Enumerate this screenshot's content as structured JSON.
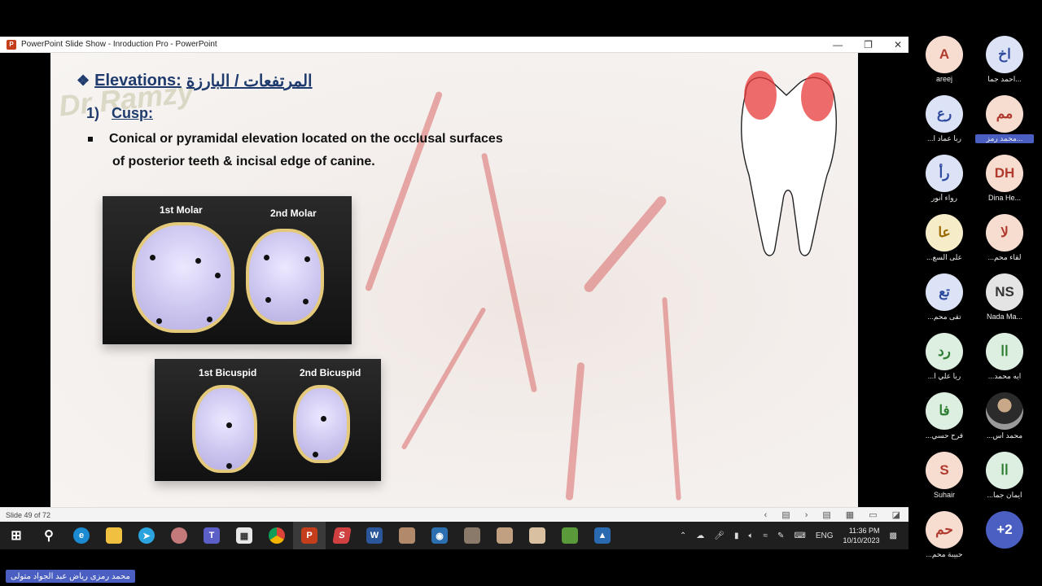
{
  "window": {
    "title": "PowerPoint Slide Show - Inroduction Pro - PowerPoint",
    "app_icon": "P"
  },
  "slide": {
    "title_en": "Elevations:",
    "title_ar": "المرتفعات / البارزة",
    "watermark": "Dr Ramzy",
    "sub_number": "1)",
    "sub_label": "Cusp:",
    "bullet_line1": "Conical or pyramidal elevation located on the occlusal surfaces",
    "bullet_line2": "of posterior teeth & incisal edge of canine.",
    "photos": {
      "molar1": "1st Molar",
      "molar2": "2nd Molar",
      "bicuspid1": "1st Bicuspid",
      "bicuspid2": "2nd Bicuspid"
    }
  },
  "status": {
    "slide_counter": "Slide 49 of 72"
  },
  "taskbar": {
    "icons": [
      "windows-start-icon",
      "search-icon",
      "edge-icon",
      "file-explorer-icon",
      "telegram-icon",
      "app-icon",
      "teams-icon",
      "store-icon",
      "chrome-icon",
      "powerpoint-icon",
      "app-icon",
      "word-icon",
      "photo-icon",
      "app-icon",
      "photo-icon",
      "photo-icon",
      "photo-icon",
      "minecraft-icon",
      "app-icon"
    ],
    "language": "ENG",
    "time": "11:36 PM",
    "date": "10/10/2023"
  },
  "participants": [
    {
      "initials": "A",
      "name": "areej",
      "bg": "#f7dcd0",
      "fg": "#b03a2e"
    },
    {
      "initials": "اخ",
      "name": "احمد جما...",
      "bg": "#dce3f7",
      "fg": "#2e4a9e"
    },
    {
      "initials": "رع",
      "name": "...ربا عماد ا",
      "bg": "#dce3f7",
      "fg": "#2e4a9e"
    },
    {
      "initials": "مم",
      "name": "محمد رمز...",
      "bg": "#f7dcd0",
      "fg": "#b03a2e",
      "highlight": true
    },
    {
      "initials": "رأ",
      "name": "رواء أنور",
      "bg": "#dce3f7",
      "fg": "#2e4a9e"
    },
    {
      "initials": "DH",
      "name": "Dina He...",
      "bg": "#f7dcd0",
      "fg": "#b03a2e"
    },
    {
      "initials": "عا",
      "name": "...على السع",
      "bg": "#f7ecc8",
      "fg": "#9a6a00"
    },
    {
      "initials": "لا",
      "name": "...لقاء محم",
      "bg": "#f7dcd0",
      "fg": "#b03a2e"
    },
    {
      "initials": "تع",
      "name": "...تقى محم",
      "bg": "#dce3f7",
      "fg": "#2e4a9e"
    },
    {
      "initials": "NS",
      "name": "Nada Ma...",
      "bg": "#e4e4e4",
      "fg": "#333333"
    },
    {
      "initials": "رد",
      "name": "...ربا علي ا",
      "bg": "#dcefe0",
      "fg": "#2e7d32"
    },
    {
      "initials": "اا",
      "name": "...ايه محمد",
      "bg": "#dcefe0",
      "fg": "#2e7d32"
    },
    {
      "initials": "فا",
      "name": "...فرح حسي",
      "bg": "#dcefe0",
      "fg": "#2e7d32"
    },
    {
      "initials": "",
      "name": "...محمد اس",
      "bg": "#8a8a8a",
      "fg": "#ffffff",
      "photo": true
    },
    {
      "initials": "S",
      "name": "Suhair",
      "bg": "#f7dcd0",
      "fg": "#b03a2e"
    },
    {
      "initials": "اا",
      "name": "...ايمان جما",
      "bg": "#dcefe0",
      "fg": "#2e7d32"
    },
    {
      "initials": "حم",
      "name": "...حبيبة محم",
      "bg": "#f7dcd0",
      "fg": "#b03a2e"
    },
    {
      "initials": "+2",
      "name": "",
      "bg": "#4a5fc1",
      "fg": "#ffffff"
    }
  ],
  "speaker_label": "محمد رمزى رياض عبد الجواد متولى"
}
